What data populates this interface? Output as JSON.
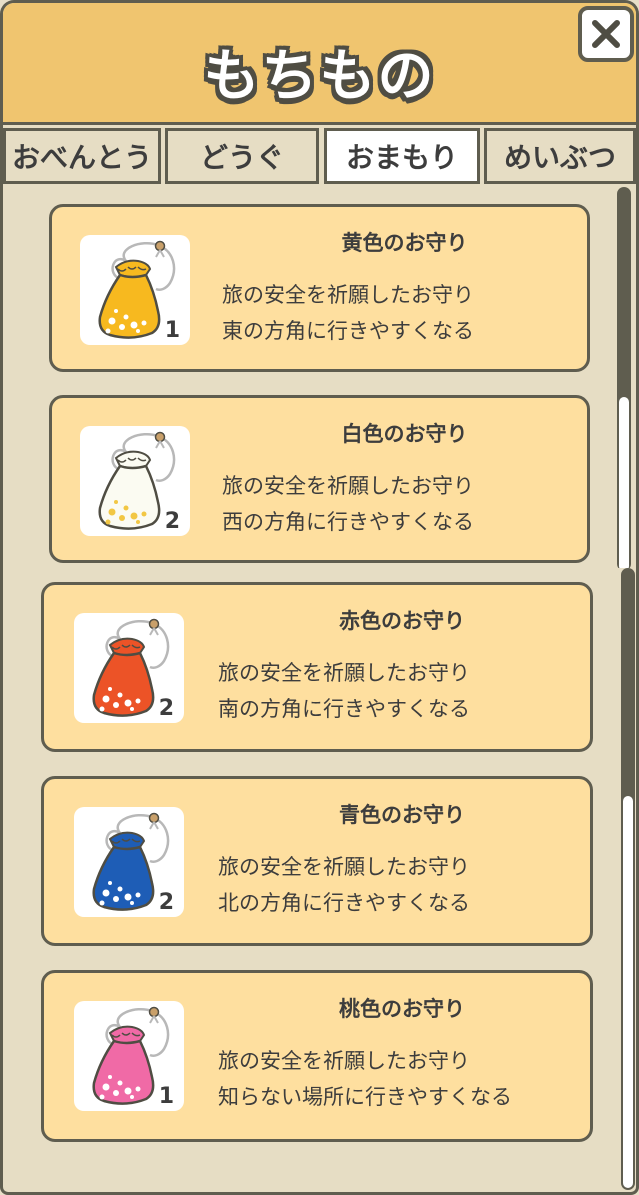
{
  "header": {
    "title": "もちもの"
  },
  "tabs": [
    {
      "label": "おべんとう",
      "active": false
    },
    {
      "label": "どうぐ",
      "active": false
    },
    {
      "label": "おまもり",
      "active": true
    },
    {
      "label": "めいぶつ",
      "active": false
    }
  ],
  "items_top": [
    {
      "name": "黄色のお守り",
      "line1": "旅の安全を祈願したお守り",
      "line2": "東の方角に行きやすくなる",
      "count": "1",
      "color": "#f7b91f"
    },
    {
      "name": "白色のお守り",
      "line1": "旅の安全を祈願したお守り",
      "line2": "西の方角に行きやすくなる",
      "count": "2",
      "color": "#fbfbf2"
    }
  ],
  "items_bottom": [
    {
      "name": "赤色のお守り",
      "line1": "旅の安全を祈願したお守り",
      "line2": "南の方角に行きやすくなる",
      "count": "2",
      "color": "#ec5327"
    },
    {
      "name": "青色のお守り",
      "line1": "旅の安全を祈願したお守り",
      "line2": "北の方角に行きやすくなる",
      "count": "2",
      "color": "#1e5db6"
    },
    {
      "name": "桃色のお守り",
      "line1": "旅の安全を祈願したお守り",
      "line2": "知らない場所に行きやすくなる",
      "count": "1",
      "color": "#f06aa6"
    }
  ],
  "colors": {
    "border": "#5f5d4f",
    "header": "#f0c56f",
    "card": "#fedf9f",
    "panel": "#e6ddc4"
  },
  "icons": {
    "close": "close-icon",
    "charm": "omamori-charm-icon"
  }
}
